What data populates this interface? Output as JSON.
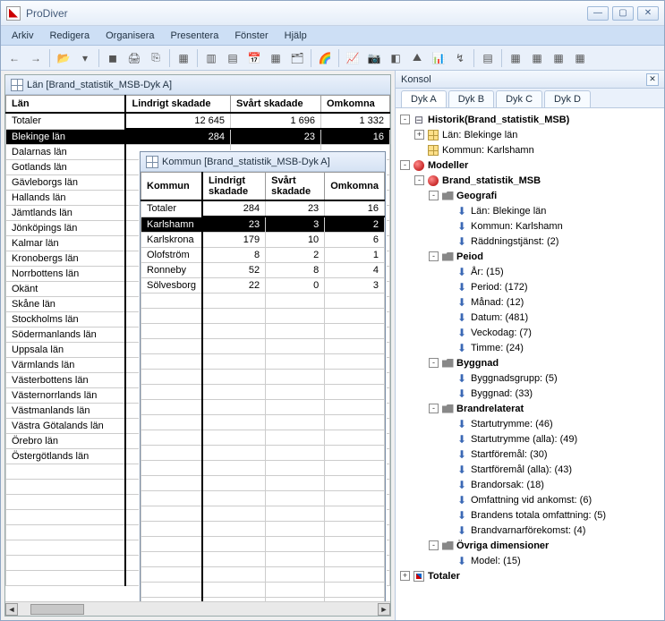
{
  "app": {
    "title": "ProDiver"
  },
  "menus": [
    "Arkiv",
    "Redigera",
    "Organisera",
    "Presentera",
    "Fönster",
    "Hjälp"
  ],
  "toolbar_icons": [
    "←",
    "→",
    "📂",
    "▾",
    "◼",
    "🖨",
    "⎘",
    "▦",
    "▥",
    "▤",
    "📅",
    "▦",
    "🗂",
    "🌈",
    "📈",
    "📷",
    "◧",
    "⛰",
    "📊",
    "↯",
    "▤",
    "▦",
    "▦",
    "▦",
    "▦"
  ],
  "lan_panel": {
    "title": "Län [Brand_statistik_MSB-Dyk A]",
    "headers": [
      "Län",
      "Lindrigt skadade",
      "Svårt skadade",
      "Omkomna"
    ],
    "rows": [
      {
        "n": "Totaler",
        "v": [
          "12 645",
          "1 696",
          "1 332"
        ],
        "total": true
      },
      {
        "n": "Blekinge län",
        "v": [
          "284",
          "23",
          "16"
        ],
        "sel": true
      },
      {
        "n": "Dalarnas län",
        "v": [
          "",
          "",
          ""
        ]
      },
      {
        "n": "Gotlands län",
        "v": [
          "",
          "",
          ""
        ]
      },
      {
        "n": "Gävleborgs län",
        "v": [
          "",
          "",
          ""
        ]
      },
      {
        "n": "Hallands län",
        "v": [
          "",
          "",
          ""
        ]
      },
      {
        "n": "Jämtlands län",
        "v": [
          "",
          "",
          ""
        ]
      },
      {
        "n": "Jönköpings län",
        "v": [
          "",
          "",
          ""
        ]
      },
      {
        "n": "Kalmar län",
        "v": [
          "",
          "",
          ""
        ]
      },
      {
        "n": "Kronobergs län",
        "v": [
          "",
          "",
          ""
        ]
      },
      {
        "n": "Norrbottens län",
        "v": [
          "",
          "",
          ""
        ]
      },
      {
        "n": "Okänt",
        "v": [
          "",
          "",
          ""
        ]
      },
      {
        "n": "Skåne län",
        "v": [
          "",
          "",
          ""
        ]
      },
      {
        "n": "Stockholms län",
        "v": [
          "",
          "",
          ""
        ]
      },
      {
        "n": "Södermanlands län",
        "v": [
          "",
          "",
          ""
        ]
      },
      {
        "n": "Uppsala län",
        "v": [
          "",
          "",
          ""
        ]
      },
      {
        "n": "Värmlands län",
        "v": [
          "",
          "",
          ""
        ]
      },
      {
        "n": "Västerbottens län",
        "v": [
          "",
          "",
          ""
        ]
      },
      {
        "n": "Västernorrlands län",
        "v": [
          "",
          "",
          ""
        ]
      },
      {
        "n": "Västmanlands län",
        "v": [
          "",
          "",
          ""
        ]
      },
      {
        "n": "Västra Götalands län",
        "v": [
          "",
          "",
          ""
        ]
      },
      {
        "n": "Örebro län",
        "v": [
          "",
          "",
          ""
        ]
      },
      {
        "n": "Östergötlands län",
        "v": [
          "",
          "",
          ""
        ]
      }
    ]
  },
  "kmn_panel": {
    "title": "Kommun [Brand_statistik_MSB-Dyk A]",
    "headers": [
      "Kommun",
      "Lindrigt skadade",
      "Svårt skadade",
      "Omkomna"
    ],
    "rows": [
      {
        "n": "Totaler",
        "v": [
          "284",
          "23",
          "16"
        ],
        "total": true
      },
      {
        "n": "Karlshamn",
        "v": [
          "23",
          "3",
          "2"
        ],
        "sel": true
      },
      {
        "n": "Karlskrona",
        "v": [
          "179",
          "10",
          "6"
        ]
      },
      {
        "n": "Olofström",
        "v": [
          "8",
          "2",
          "1"
        ]
      },
      {
        "n": "Ronneby",
        "v": [
          "52",
          "8",
          "4"
        ]
      },
      {
        "n": "Sölvesborg",
        "v": [
          "22",
          "0",
          "3"
        ]
      }
    ]
  },
  "konsol": {
    "title": "Konsol",
    "tabs": [
      "Dyk A",
      "Dyk B",
      "Dyk C",
      "Dyk D"
    ],
    "tree": [
      {
        "d": 0,
        "exp": "-",
        "ic": "hist",
        "t": "Historik(Brand_statistik_MSB)",
        "b": true
      },
      {
        "d": 1,
        "exp": "+",
        "ic": "grid",
        "t": "Län: Blekinge län"
      },
      {
        "d": 1,
        "exp": " ",
        "ic": "grid",
        "t": "Kommun: Karlshamn"
      },
      {
        "d": 0,
        "exp": "-",
        "ic": "model",
        "t": "Modeller",
        "b": true
      },
      {
        "d": 1,
        "exp": "-",
        "ic": "model",
        "t": "Brand_statistik_MSB",
        "b": true
      },
      {
        "d": 2,
        "exp": "-",
        "ic": "folder",
        "t": "Geografi",
        "b": true
      },
      {
        "d": 3,
        "exp": " ",
        "ic": "down",
        "t": "Län: Blekinge län"
      },
      {
        "d": 3,
        "exp": " ",
        "ic": "down",
        "t": "Kommun: Karlshamn"
      },
      {
        "d": 3,
        "exp": " ",
        "ic": "down",
        "t": "Räddningstjänst: (2)"
      },
      {
        "d": 2,
        "exp": "-",
        "ic": "folder",
        "t": "Peiod",
        "b": true
      },
      {
        "d": 3,
        "exp": " ",
        "ic": "down",
        "t": "År: (15)"
      },
      {
        "d": 3,
        "exp": " ",
        "ic": "down",
        "t": "Period: (172)"
      },
      {
        "d": 3,
        "exp": " ",
        "ic": "down",
        "t": "Månad: (12)"
      },
      {
        "d": 3,
        "exp": " ",
        "ic": "down",
        "t": "Datum: (481)"
      },
      {
        "d": 3,
        "exp": " ",
        "ic": "down",
        "t": "Veckodag: (7)"
      },
      {
        "d": 3,
        "exp": " ",
        "ic": "down",
        "t": "Timme: (24)"
      },
      {
        "d": 2,
        "exp": "-",
        "ic": "folder",
        "t": "Byggnad",
        "b": true
      },
      {
        "d": 3,
        "exp": " ",
        "ic": "down",
        "t": "Byggnadsgrupp: (5)"
      },
      {
        "d": 3,
        "exp": " ",
        "ic": "down",
        "t": "Byggnad: (33)"
      },
      {
        "d": 2,
        "exp": "-",
        "ic": "folder",
        "t": "Brandrelaterat",
        "b": true
      },
      {
        "d": 3,
        "exp": " ",
        "ic": "down",
        "t": "Startutrymme: (46)"
      },
      {
        "d": 3,
        "exp": " ",
        "ic": "down",
        "t": "Startutrymme (alla): (49)"
      },
      {
        "d": 3,
        "exp": " ",
        "ic": "down",
        "t": "Startföremål: (30)"
      },
      {
        "d": 3,
        "exp": " ",
        "ic": "down",
        "t": "Startföremål (alla): (43)"
      },
      {
        "d": 3,
        "exp": " ",
        "ic": "down",
        "t": "Brandorsak: (18)"
      },
      {
        "d": 3,
        "exp": " ",
        "ic": "down",
        "t": "Omfattning vid ankomst: (6)"
      },
      {
        "d": 3,
        "exp": " ",
        "ic": "down",
        "t": "Brandens totala omfattning: (5)"
      },
      {
        "d": 3,
        "exp": " ",
        "ic": "down",
        "t": "Brandvarnarförekomst: (4)"
      },
      {
        "d": 2,
        "exp": "-",
        "ic": "folder",
        "t": "Övriga dimensioner",
        "b": true
      },
      {
        "d": 3,
        "exp": " ",
        "ic": "down",
        "t": "Model: (15)"
      },
      {
        "d": 0,
        "exp": "+",
        "ic": "tot",
        "t": "Totaler",
        "b": true
      }
    ]
  }
}
